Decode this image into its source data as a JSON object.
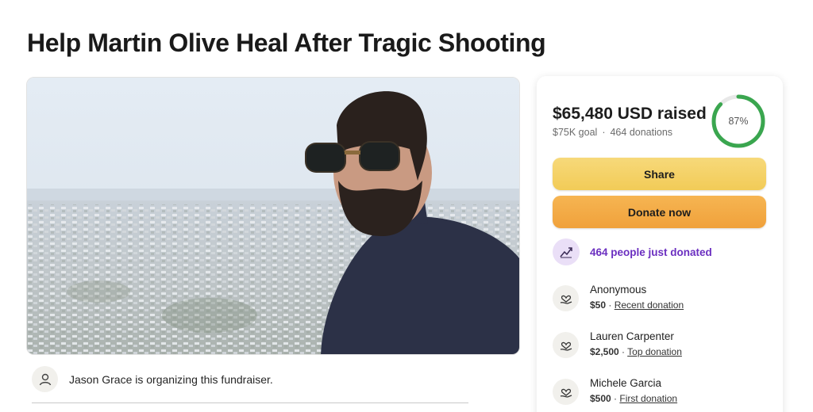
{
  "page": {
    "title": "Help Martin Olive Heal After Tragic Shooting"
  },
  "organizer": {
    "text": "Jason Grace is organizing this fundraiser.",
    "icon": "person-icon"
  },
  "stats": {
    "raised": "$65,480 USD raised",
    "goal": "$75K goal",
    "separator": "·",
    "donations": "464 donations",
    "percent_label": "87%",
    "percent_value": 0.87,
    "ring_color": "#3aa64f",
    "ring_track_color": "#e8e8e8"
  },
  "buttons": {
    "share": "Share",
    "donate": "Donate now"
  },
  "trend": {
    "text": "464 people just donated",
    "icon": "trending-up-icon",
    "color": "#6b2fc0"
  },
  "donations": [
    {
      "name": "Anonymous",
      "amount": "$50",
      "sep": "·",
      "tag": "Recent donation"
    },
    {
      "name": "Lauren Carpenter",
      "amount": "$2,500",
      "sep": "·",
      "tag": "Top donation"
    },
    {
      "name": "Michele Garcia",
      "amount": "$500",
      "sep": "·",
      "tag": "First donation"
    }
  ]
}
